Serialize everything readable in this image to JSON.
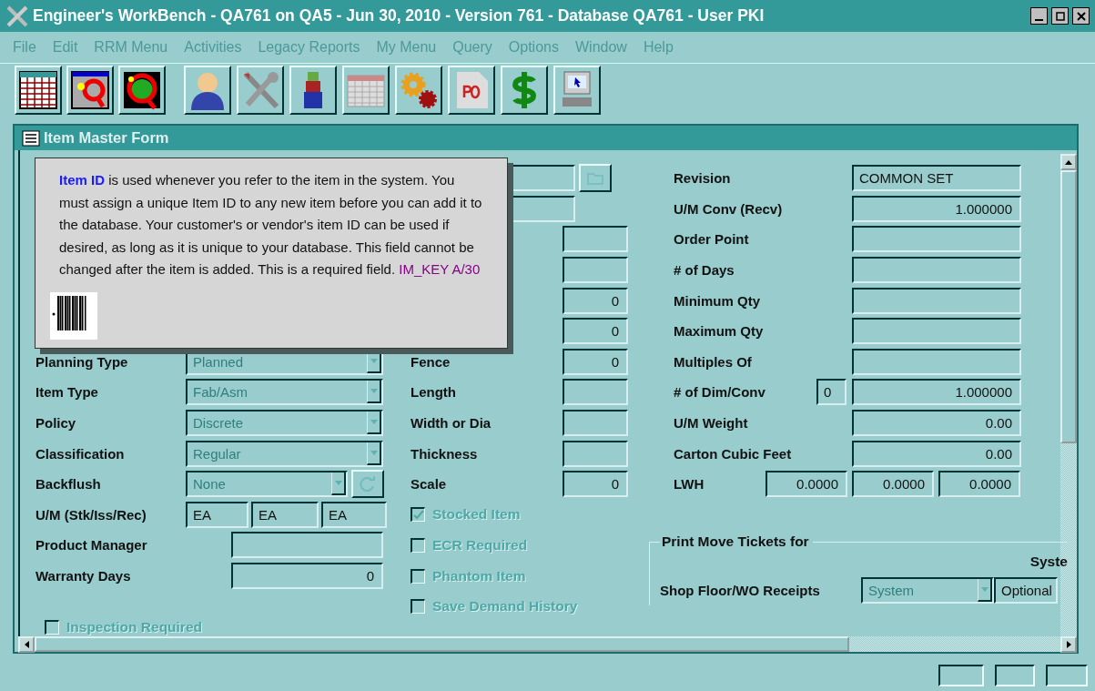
{
  "window": {
    "title": "Engineer's WorkBench - QA761 on QA5 - Jun 30, 2010 - Version 761 - Database QA761 - User PKI"
  },
  "menu": [
    "File",
    "Edit",
    "RRM Menu",
    "Activities",
    "Legacy Reports",
    "My Menu",
    "Query",
    "Options",
    "Window",
    "Help"
  ],
  "form": {
    "title": "Item Master Form",
    "tooltip": {
      "text": "**Item ID** is used whenever you refer to the item in the system.  You must assign a unique Item ID to any new item before you can add it to the database.  Your customer's or vendor's item ID can be used if desired, as long as it is unique to your database.  This field cannot be changed after the item is added.  This is a required field.",
      "code": "IM_KEY",
      "format": "A/30"
    },
    "left": [
      {
        "kind": "dropdown",
        "label": "Planning Type",
        "value": "Planned",
        "disabled": true
      },
      {
        "kind": "dropdown",
        "label": "Item Type",
        "value": "Fab/Asm",
        "disabled": true
      },
      {
        "kind": "dropdown",
        "label": "Policy",
        "value": "Discrete",
        "disabled": true
      },
      {
        "kind": "dropdown",
        "label": "Classification",
        "value": "Regular",
        "disabled": true
      },
      {
        "kind": "dropdown_button",
        "label": "Backflush",
        "value": "None",
        "disabled": true
      },
      {
        "kind": "triple",
        "label": "U/M (Stk/Iss/Rec)",
        "values": [
          "EA",
          "EA",
          "EA"
        ]
      },
      {
        "kind": "text",
        "label": "Product Manager"
      },
      {
        "kind": "number",
        "label": "Warranty Days",
        "value": "0"
      }
    ],
    "left_checkboxes": [
      {
        "label": "Inspection Required",
        "checked": false,
        "disabled": true
      }
    ],
    "middle": [
      {
        "kind": "lookup"
      },
      {
        "kind": "wide"
      },
      {
        "kind": "small"
      },
      {
        "kind": "small"
      },
      {
        "kind": "small",
        "value": "0"
      },
      {
        "kind": "small",
        "value": "0"
      },
      {
        "kind": "small",
        "label": "Fence",
        "value": "0"
      },
      {
        "kind": "small",
        "label": "Length"
      },
      {
        "kind": "small",
        "label": "Width or Dia"
      },
      {
        "kind": "small",
        "label": "Thickness"
      },
      {
        "kind": "small",
        "label": "Scale",
        "value": "0"
      }
    ],
    "middle_checkboxes": [
      {
        "label": "Stocked Item",
        "checked": true,
        "disabled": true
      },
      {
        "label": "ECR Required",
        "checked": false,
        "disabled": true
      },
      {
        "label": "Phantom Item",
        "checked": false,
        "disabled": true
      },
      {
        "label": "Save Demand History",
        "checked": false,
        "disabled": true
      }
    ],
    "right": [
      {
        "kind": "text",
        "label": "Revision",
        "value": "COMMON SET"
      },
      {
        "kind": "number",
        "label": "U/M Conv (Recv)",
        "value": "1.000000"
      },
      {
        "kind": "number",
        "label": "Order Point"
      },
      {
        "kind": "number",
        "label": "# of Days"
      },
      {
        "kind": "number",
        "label": "Minimum Qty"
      },
      {
        "kind": "number",
        "label": "Maximum Qty"
      },
      {
        "kind": "number",
        "label": "Multiples Of"
      },
      {
        "kind": "prefixed",
        "label": "# of Dim/Conv",
        "prefix": "0",
        "value": "1.000000"
      },
      {
        "kind": "number",
        "label": "U/M Weight",
        "value": "0.00"
      },
      {
        "kind": "number",
        "label": "Carton Cubic Feet",
        "value": "0.00"
      },
      {
        "kind": "triple",
        "label": "LWH",
        "values": [
          "0.0000",
          "0.0000",
          "0.0000"
        ]
      }
    ],
    "print_tickets": {
      "title": "Print Move Tickets for",
      "column": "Syste",
      "rows": [
        {
          "label": "Shop Floor/WO Receipts",
          "value": "System",
          "disabled": true,
          "option": "Optional"
        }
      ]
    }
  }
}
